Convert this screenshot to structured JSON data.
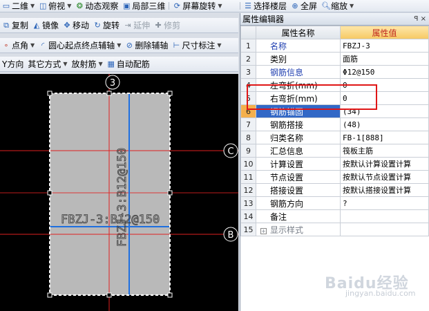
{
  "toolbar1": {
    "items": [
      "二维",
      "俯视",
      "动态观察",
      "局部三维",
      "屏幕旋转"
    ]
  },
  "toolbar1_right": {
    "items": [
      "选择楼层",
      "全屏",
      "缩放"
    ]
  },
  "toolbar2": {
    "items": [
      "复制",
      "镜像",
      "移动",
      "旋转",
      "延伸",
      "修剪"
    ]
  },
  "toolbar3": {
    "items": [
      "点角",
      "圆心起点终点辅轴",
      "删除辅轴",
      "尺寸标注"
    ]
  },
  "toolbar4": {
    "items": [
      "Y方向",
      "其它方式",
      "放射筋",
      "自动配筋"
    ]
  },
  "canvas": {
    "axis_labels": [
      "3",
      "C",
      "B"
    ],
    "rebar_horizontal_label": "FBZJ-3:B12@150",
    "rebar_vertical_label": "FBZJ-3:B12@150",
    "colors": {
      "background": "#000000",
      "slab_fill": "#b9b9b9",
      "axis_line": "#e02020",
      "rebar_line": "#1e6fe0",
      "selection_border": "#ffffff"
    }
  },
  "panel": {
    "title": "属性编辑器",
    "pin": "ꟼ ×",
    "headers": {
      "name": "属性名称",
      "value": "属性值"
    },
    "rows": [
      {
        "idx": "1",
        "name": "名称",
        "value": "FBZJ-3"
      },
      {
        "idx": "2",
        "name": "类别",
        "value": "面筋"
      },
      {
        "idx": "3",
        "name": "钢筋信息",
        "value": "Φ12@150"
      },
      {
        "idx": "4",
        "name": "左弯折(mm)",
        "value": "0"
      },
      {
        "idx": "5",
        "name": "右弯折(mm)",
        "value": "0"
      },
      {
        "idx": "6",
        "name": "钢筋锚固",
        "value": "(34)"
      },
      {
        "idx": "7",
        "name": "钢筋搭接",
        "value": "(48)"
      },
      {
        "idx": "8",
        "name": "归类名称",
        "value": "FB-1[888]"
      },
      {
        "idx": "9",
        "name": "汇总信息",
        "value": "筏板主筋"
      },
      {
        "idx": "10",
        "name": "计算设置",
        "value": "按默认计算设置计算"
      },
      {
        "idx": "11",
        "name": "节点设置",
        "value": "按默认节点设置计算"
      },
      {
        "idx": "12",
        "name": "搭接设置",
        "value": "按默认搭接设置计算"
      },
      {
        "idx": "13",
        "name": "钢筋方向",
        "value": "?"
      },
      {
        "idx": "14",
        "name": "备注",
        "value": ""
      },
      {
        "idx": "15",
        "name": "显示样式",
        "value": ""
      }
    ],
    "expander": "+"
  },
  "watermark": {
    "main": "Baidu经验",
    "sub": "jingyan.baidu.com"
  }
}
